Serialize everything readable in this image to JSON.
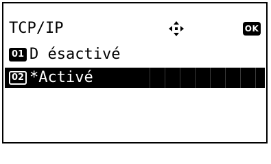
{
  "header": {
    "title": "TCP/IP",
    "nav_icon": "four-way-arrow-icon",
    "ok_label": "OK"
  },
  "options": [
    {
      "number": "01",
      "label": "D ésactivé",
      "selected": false
    },
    {
      "number": "02",
      "label": "*Activé",
      "selected": true
    }
  ],
  "colors": {
    "foreground": "#000000",
    "background": "#ffffff",
    "selection": "#000000"
  }
}
